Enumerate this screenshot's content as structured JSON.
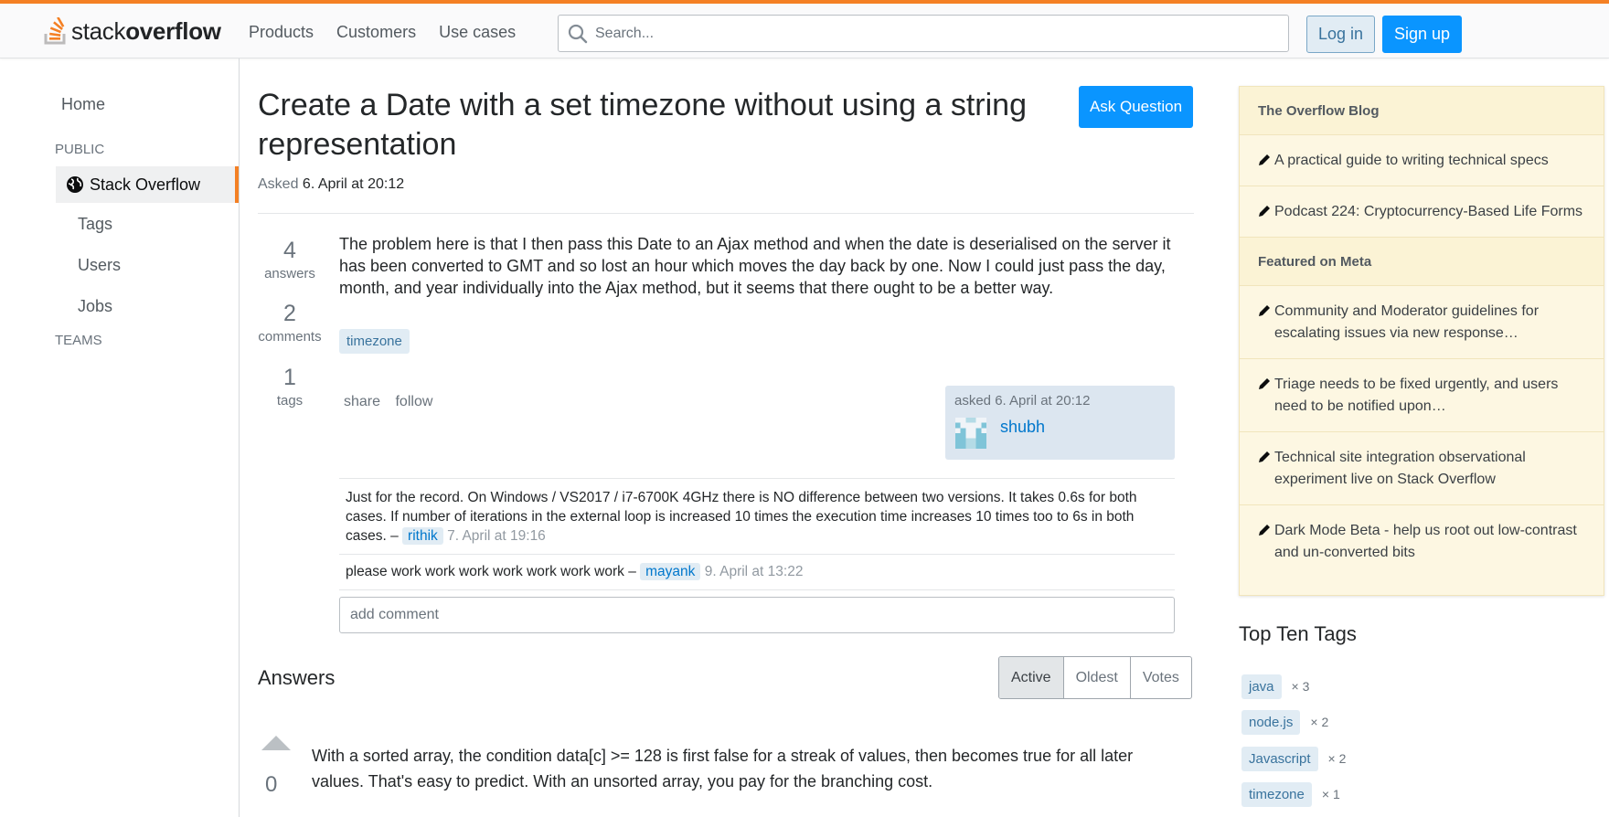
{
  "header": {
    "logo_light": "stack",
    "logo_bold": "overflow",
    "nav": [
      "Products",
      "Customers",
      "Use cases"
    ],
    "search_placeholder": "Search...",
    "login_label": "Log in",
    "signup_label": "Sign up",
    "accent_color": "#f48024"
  },
  "sidebar": {
    "home": "Home",
    "public_label": "PUBLIC",
    "active_item": "Stack Overflow",
    "items": [
      "Tags",
      "Users",
      "Jobs"
    ],
    "teams_label": "TEAMS"
  },
  "question": {
    "title": "Create a Date with a set timezone without using a string representation",
    "ask_button": "Ask Question",
    "asked_prefix": "Asked",
    "asked_date": "6. April at 20:12",
    "stats": [
      {
        "num": "4",
        "label": "answers"
      },
      {
        "num": "2",
        "label": "comments"
      },
      {
        "num": "1",
        "label": "tags"
      }
    ],
    "body": "The problem here is that I then pass this Date to an Ajax method and when the date is deserialised on the server it has been converted to GMT and so lost an hour which moves the day back by one. Now I could just pass the day, month, and year individually into the Ajax method, but it seems that there ought to be a better way.",
    "tag": "timezone",
    "share_label": "share",
    "follow_label": "follow",
    "card_asked": "asked 6. April at 20:12",
    "author": "shubh"
  },
  "comments": [
    {
      "text": "Just for the record. On Windows / VS2017 / i7-6700K 4GHz there is NO difference between two versions. It takes 0.6s for both cases. If number of iterations in the external loop is increased 10 times the execution time increases 10 times too to 6s in both cases. –",
      "user": "rithik",
      "date": "7. April at 19:16"
    },
    {
      "text": "please work work work work work work work –",
      "user": "mayank",
      "date": "9. April at 13:22"
    }
  ],
  "add_comment": "add comment",
  "answers": {
    "heading": "Answers",
    "sort": [
      "Active",
      "Oldest",
      "Votes"
    ],
    "first": {
      "votes": "0",
      "body": "With a sorted array, the condition data[c] >= 128 is first false for a streak of values, then becomes true for all later values. That's easy to predict. With an unsorted array, you pay for the branching cost."
    }
  },
  "blog": {
    "overflow_blog_title": "The Overflow Blog",
    "overflow_blog_items": [
      "A practical guide to writing technical specs",
      "Podcast 224: Cryptocurrency-Based Life Forms"
    ],
    "meta_title": "Featured on Meta",
    "meta_items": [
      "Community and Moderator guidelines for escalating issues via new response…",
      "Triage needs to be fixed urgently, and users need to be notified upon…",
      "Technical site integration observational experiment live on Stack Overflow",
      "Dark Mode Beta - help us root out low-contrast and un-converted bits"
    ]
  },
  "top_tags": {
    "heading": "Top Ten Tags",
    "items": [
      {
        "name": "java",
        "count": "× 3"
      },
      {
        "name": "node.js",
        "count": "× 2"
      },
      {
        "name": "Javascript",
        "count": "× 2"
      },
      {
        "name": "timezone",
        "count": "× 1"
      }
    ]
  }
}
